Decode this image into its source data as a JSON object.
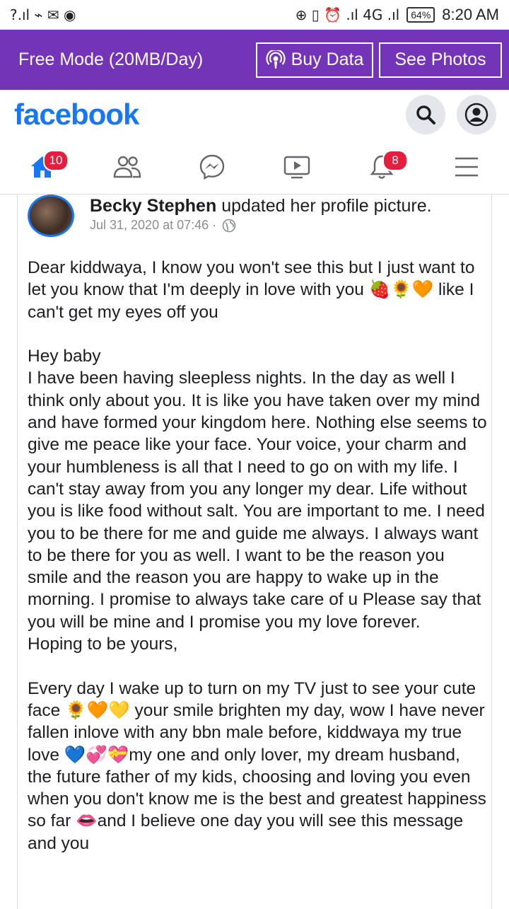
{
  "status_bar": {
    "left_glyphs": "?.ıl ⌁ ✉ ◉",
    "right_glyphs": "⊕ ▯ ⏰ .ıl 4G .ıl",
    "battery": "64%",
    "time": "8:20 AM"
  },
  "free_bar": {
    "mode": "Free Mode (20MB/Day)",
    "buy_data": "Buy Data",
    "see_photos": "See Photos"
  },
  "header": {
    "logo": "facebook"
  },
  "nav": {
    "home_badge": "10",
    "notifications_badge": "8"
  },
  "post": {
    "author": "Becky Stephen",
    "action": " updated her profile picture.",
    "date": "Jul 31, 2020 at 07:46 ·",
    "paragraphs": [
      "Dear kiddwaya, I know you won't see this but I just want to let you know that I'm deeply in love with you 🍓🌻🧡 like I can't get my eyes off you",
      "Hey baby\nI have been having sleepless nights. In the day as well I think only about you. It is like you have taken over my mind and have formed your kingdom here. Nothing else seems to give me peace like your face. Your voice, your charm and your humbleness is all that I need to go on with my life. I can't stay away from you any longer my dear. Life without you is like food without salt. You are important to me. I need you to be there for me and guide me always. I always want to be there for you as well. I want to be the reason you smile and the reason you are happy to wake up in the morning. I promise to always take care of u Please say that you will be mine and I promise you my love forever.\nHoping to be yours,",
      "Every day I wake up to turn on my TV just to see your cute face 🌻🧡💛 your smile brighten my day, wow I have never fallen inlove with any bbn male before, kiddwaya my true love 💙💞💝my one and only lover, my dream husband, the future father of my kids, choosing and loving you even when you don't know me is the best and greatest happiness so far 👄and I believe one day you will see this message and you"
    ]
  }
}
